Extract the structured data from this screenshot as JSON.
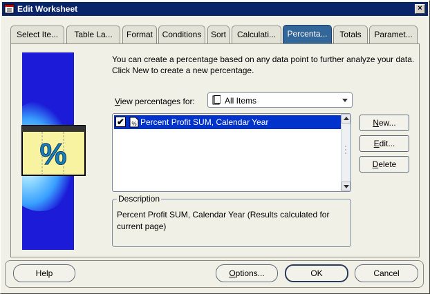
{
  "window": {
    "title": "Edit Worksheet",
    "close_glyph": "×"
  },
  "tabs": [
    {
      "label": "Select Ite...",
      "active": false
    },
    {
      "label": "Table La...",
      "active": false
    },
    {
      "label": "Format",
      "active": false
    },
    {
      "label": "Conditions",
      "active": false
    },
    {
      "label": "Sort",
      "active": false
    },
    {
      "label": "Calculati...",
      "active": false
    },
    {
      "label": "Percenta...",
      "active": true
    },
    {
      "label": "Totals",
      "active": false
    },
    {
      "label": "Paramet...",
      "active": false
    }
  ],
  "panel": {
    "intro_text": "You can create a percentage based on any data point to further analyze your data.  Click New to create a new percentage.",
    "artwork_glyph": "%",
    "view_label_prefix": "V",
    "view_label_rest": "iew percentages for:",
    "view_select": {
      "value": "All Items",
      "icon": "folder-icon"
    },
    "list_items": [
      {
        "label": "Percent Profit SUM, Calendar Year",
        "checked": true,
        "selected": true,
        "check_glyph": "✔",
        "icon": "percent-item-icon"
      }
    ],
    "buttons": {
      "new_mn": "N",
      "new_rest": "ew...",
      "edit_mn": "E",
      "edit_rest": "dit...",
      "delete_mn": "D",
      "delete_rest": "elete"
    },
    "description": {
      "legend": "Description",
      "text": "Percent Profit SUM, Calendar Year (Results calculated for current page)"
    }
  },
  "footer": {
    "help": "Help",
    "options_mn": "O",
    "options_rest": "ptions...",
    "ok": "OK",
    "cancel": "Cancel"
  },
  "colors": {
    "title_bar": "#0a246a",
    "active_tab": "#336699",
    "selection": "#0033cc",
    "artwork_blue": "#1b1bd8"
  }
}
